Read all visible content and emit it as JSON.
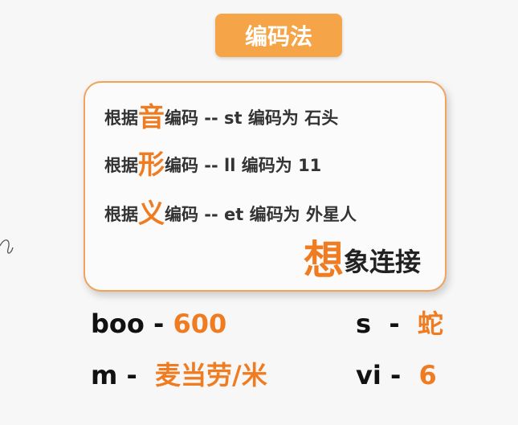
{
  "title": "编码法",
  "colors": {
    "accent": "#f5a547",
    "highlight": "#f07c22",
    "border": "#f2a25a"
  },
  "rules": [
    {
      "prefix": "根据",
      "key": "音",
      "rest": "编码 -- st 编码为 石头"
    },
    {
      "prefix": "根据",
      "key": "形",
      "rest": "编码 -- ll 编码为 11"
    },
    {
      "prefix": "根据",
      "key": "义",
      "rest": "编码 -- et 编码为 外星人"
    }
  ],
  "slogan": {
    "key": "想",
    "rest": "象连接"
  },
  "examples": [
    {
      "term": "boo - ",
      "value": "600"
    },
    {
      "term": "s  -  ",
      "value": "蛇"
    },
    {
      "term": "m -  ",
      "value": "麦当劳/米"
    },
    {
      "term": "vi -  ",
      "value": "6"
    }
  ]
}
